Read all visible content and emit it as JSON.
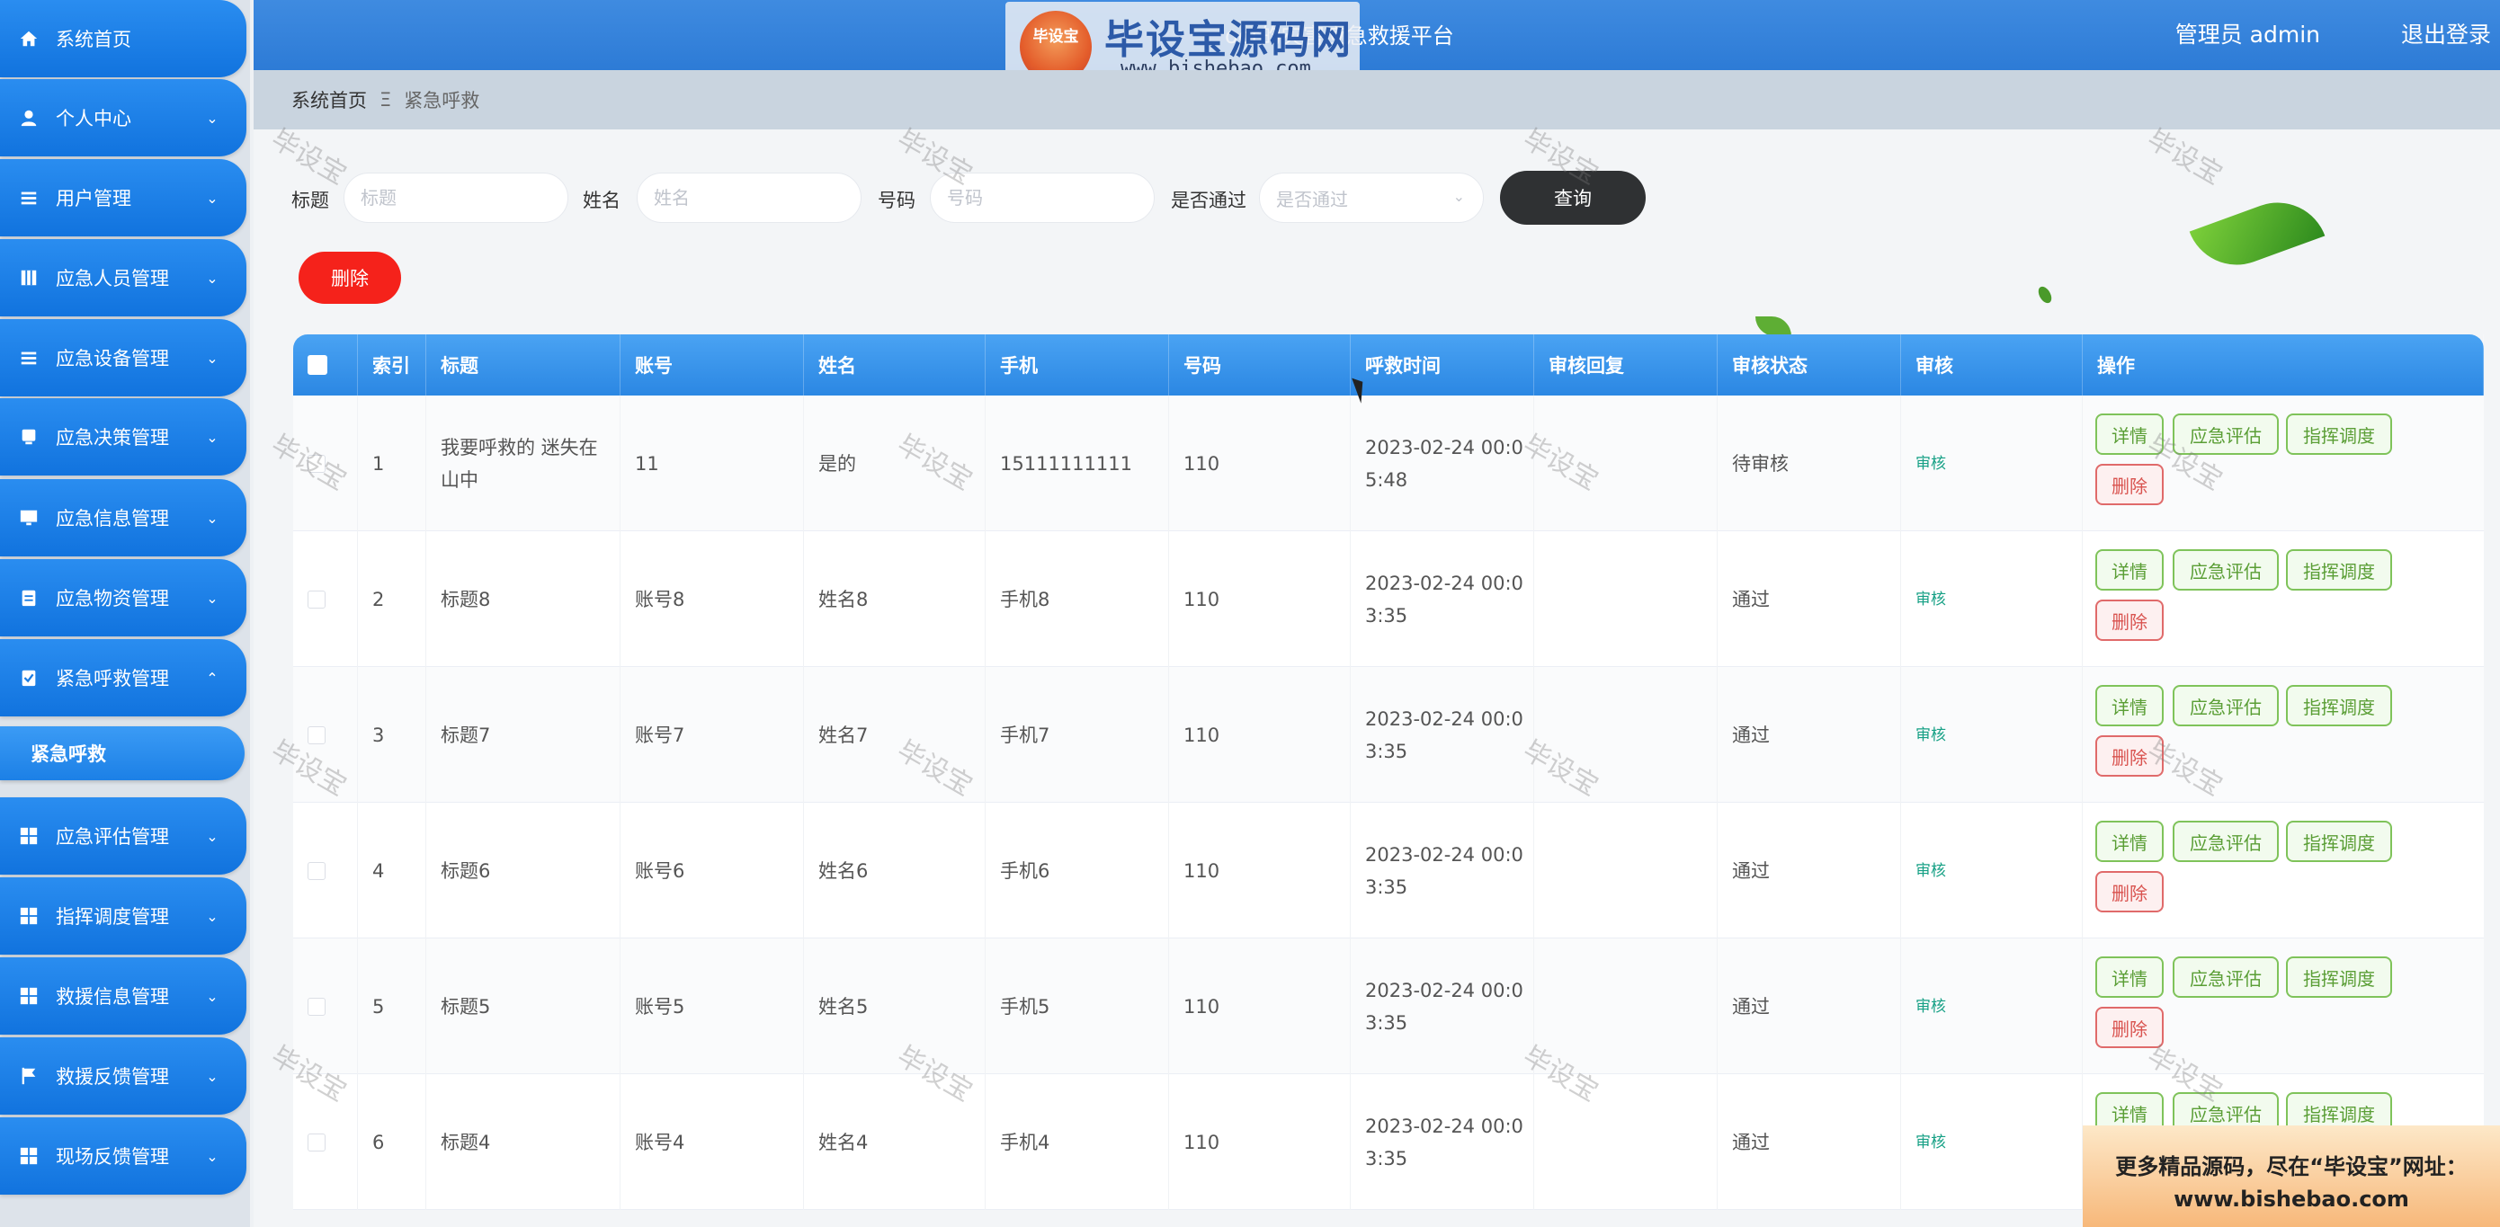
{
  "header": {
    "app_title": "oot的灾害应急救援平台",
    "user": "管理员 admin",
    "logout": "退出登录"
  },
  "logo": {
    "badge": "毕设宝",
    "name": "毕设宝源码网",
    "url": "www.bishebao.com"
  },
  "sidebar": {
    "items": [
      {
        "label": "系统首页",
        "icon": "home-icon",
        "chevron": ""
      },
      {
        "label": "个人中心",
        "icon": "user-icon",
        "chevron": "⌄"
      },
      {
        "label": "用户管理",
        "icon": "list-icon",
        "chevron": "⌄"
      },
      {
        "label": "应急人员管理",
        "icon": "book-icon",
        "chevron": "⌄"
      },
      {
        "label": "应急设备管理",
        "icon": "list-icon",
        "chevron": "⌄"
      },
      {
        "label": "应急决策管理",
        "icon": "doc-icon",
        "chevron": "⌄"
      },
      {
        "label": "应急信息管理",
        "icon": "monitor-icon",
        "chevron": "⌄"
      },
      {
        "label": "应急物资管理",
        "icon": "clipboard-icon",
        "chevron": "⌄"
      },
      {
        "label": "紧急呼救管理",
        "icon": "check-icon",
        "chevron": "⌃"
      },
      {
        "label": "应急评估管理",
        "icon": "grid-icon",
        "chevron": "⌄"
      },
      {
        "label": "指挥调度管理",
        "icon": "grid-icon",
        "chevron": "⌄"
      },
      {
        "label": "救援信息管理",
        "icon": "grid-icon",
        "chevron": "⌄"
      },
      {
        "label": "救援反馈管理",
        "icon": "flag-icon",
        "chevron": "⌄"
      },
      {
        "label": "现场反馈管理",
        "icon": "grid-icon",
        "chevron": "⌄"
      }
    ],
    "sub_item": "紧急呼救"
  },
  "breadcrumb": {
    "home": "系统首页",
    "sep": "Ξ",
    "current": "紧急呼救"
  },
  "search": {
    "title_label": "标题",
    "title_placeholder": "标题",
    "name_label": "姓名",
    "name_placeholder": "姓名",
    "number_label": "号码",
    "number_placeholder": "号码",
    "pass_label": "是否通过",
    "pass_placeholder": "是否通过",
    "query_button": "查询"
  },
  "toolbar": {
    "delete_button": "删除"
  },
  "table": {
    "columns": [
      "索引",
      "标题",
      "账号",
      "姓名",
      "手机",
      "号码",
      "呼救时间",
      "审核回复",
      "审核状态",
      "审核",
      "操作"
    ],
    "rows": [
      {
        "index": "1",
        "title": "我要呼救的 迷失在山中",
        "account": "11",
        "name": "是的",
        "phone": "15111111111",
        "number": "110",
        "time": "2023-02-24 00:05:48",
        "reply": "",
        "status": "待审核",
        "audit": "审核"
      },
      {
        "index": "2",
        "title": "标题8",
        "account": "账号8",
        "name": "姓名8",
        "phone": "手机8",
        "number": "110",
        "time": "2023-02-24 00:03:35",
        "reply": "",
        "status": "通过",
        "audit": "审核"
      },
      {
        "index": "3",
        "title": "标题7",
        "account": "账号7",
        "name": "姓名7",
        "phone": "手机7",
        "number": "110",
        "time": "2023-02-24 00:03:35",
        "reply": "",
        "status": "通过",
        "audit": "审核"
      },
      {
        "index": "4",
        "title": "标题6",
        "account": "账号6",
        "name": "姓名6",
        "phone": "手机6",
        "number": "110",
        "time": "2023-02-24 00:03:35",
        "reply": "",
        "status": "通过",
        "audit": "审核"
      },
      {
        "index": "5",
        "title": "标题5",
        "account": "账号5",
        "name": "姓名5",
        "phone": "手机5",
        "number": "110",
        "time": "2023-02-24 00:03:35",
        "reply": "",
        "status": "通过",
        "audit": "审核"
      },
      {
        "index": "6",
        "title": "标题4",
        "account": "账号4",
        "name": "姓名4",
        "phone": "手机4",
        "number": "110",
        "time": "2023-02-24 00:03:35",
        "reply": "",
        "status": "通过",
        "audit": "审核"
      }
    ],
    "ops": {
      "detail": "详情",
      "assess": "应急评估",
      "dispatch": "指挥调度",
      "delete": "删除"
    }
  },
  "watermark": "毕设宝",
  "ad": {
    "line1": "更多精品源码，尽在“毕设宝”网址：",
    "line2": "www.bishebao.com"
  },
  "colors": {
    "sidebar_blue": "#1173de",
    "header_blue": "#2d7bd6",
    "delete_red": "#f5221b",
    "op_green": "#7fc35a",
    "audit_teal": "#16a085"
  }
}
